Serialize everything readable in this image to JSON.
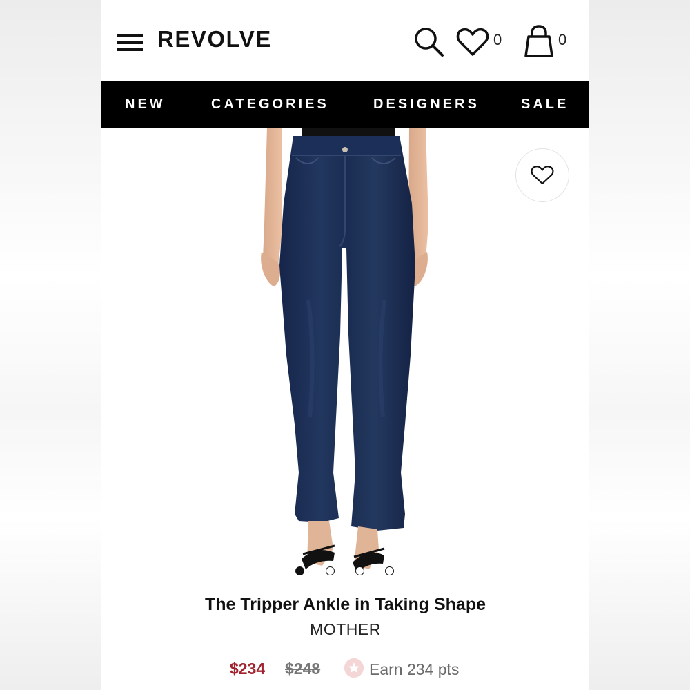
{
  "header": {
    "logo": "REVOLVE",
    "wishlist_count": "0",
    "bag_count": "0",
    "icons": [
      "hamburger-menu-icon",
      "search-icon",
      "heart-icon",
      "shopping-bag-icon"
    ]
  },
  "nav": {
    "items": [
      {
        "label": "NEW"
      },
      {
        "label": "CATEGORIES"
      },
      {
        "label": "DESIGNERS"
      },
      {
        "label": "SALE"
      }
    ]
  },
  "gallery": {
    "image_subject": "dark-wash-flare-jeans",
    "slide_count": 4,
    "active_slide": 1
  },
  "product": {
    "title": "The Tripper Ankle in Taking Shape",
    "brand": "MOTHER",
    "sale_price": "$234",
    "original_price": "$248",
    "points_text": "Earn 234 pts"
  },
  "colors": {
    "nav_bg": "#000000",
    "sale_price": "#a0232e",
    "denim": "#1d2f55"
  }
}
